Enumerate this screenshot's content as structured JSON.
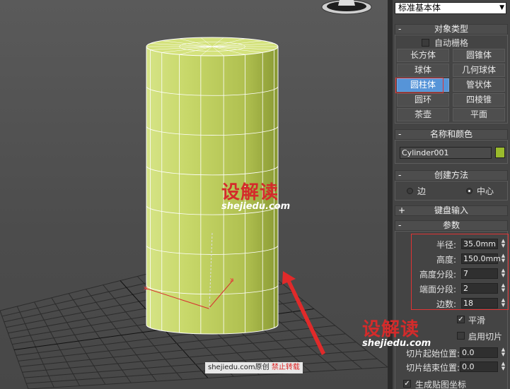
{
  "panel": {
    "category_dropdown": "标准基本体",
    "object_type": {
      "title": "对象类型",
      "auto_grid_label": "自动栅格",
      "buttons": [
        "长方体",
        "圆锥体",
        "球体",
        "几何球体",
        "圆柱体",
        "管状体",
        "圆环",
        "四棱锥",
        "茶壶",
        "平面"
      ],
      "active_button": "圆柱体"
    },
    "name_color": {
      "title": "名称和颜色",
      "name_value": "Cylinder001",
      "color": "#9aba2c"
    },
    "creation_method": {
      "title": "创建方法",
      "options": [
        "边",
        "中心"
      ],
      "selected": "中心"
    },
    "keyboard_entry": {
      "title": "键盘输入"
    },
    "parameters": {
      "title": "参数",
      "radius_label": "半径:",
      "radius_value": "35.0mm",
      "height_label": "高度:",
      "height_value": "150.0mm",
      "height_segments_label": "高度分段:",
      "height_segments_value": "7",
      "cap_segments_label": "端面分段:",
      "cap_segments_value": "2",
      "sides_label": "边数:",
      "sides_value": "18",
      "smooth_label": "平滑",
      "slice_on_label": "启用切片",
      "slice_from_label": "切片起始位置:",
      "slice_from_value": "0.0",
      "slice_to_label": "切片结束位置:",
      "slice_to_value": "0.0",
      "gen_mapping_label": "生成贴图坐标"
    }
  },
  "watermarks": {
    "logo": "设解读",
    "site": "shejiedu.com"
  },
  "credit": {
    "prefix": "shejiedu.com原创",
    "warning": "禁止转载"
  },
  "colors": {
    "cylinder": "#c8d86a",
    "highlight_box": "#e03434",
    "active_button": "#5694d8"
  }
}
